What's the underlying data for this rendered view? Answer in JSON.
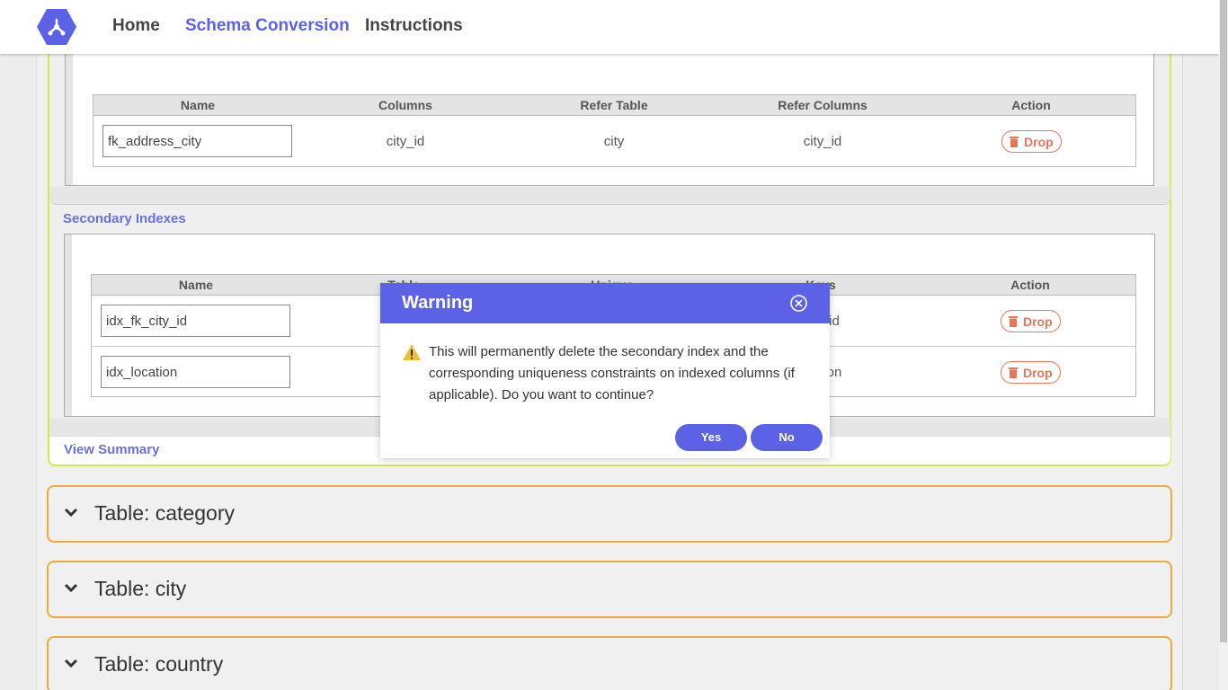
{
  "nav": {
    "home": "Home",
    "schema_conversion": "Schema Conversion",
    "instructions": "Instructions"
  },
  "foreign_keys": {
    "headers": [
      "Name",
      "Columns",
      "Refer Table",
      "Refer Columns",
      "Action"
    ],
    "rows": [
      {
        "name": "fk_address_city",
        "columns": "city_id",
        "refer_table": "city",
        "refer_columns": "city_id",
        "action": "Drop"
      }
    ]
  },
  "secondary_indexes": {
    "title": "Secondary Indexes",
    "headers": [
      "Name",
      "Table",
      "Unique",
      "Keys",
      "Action"
    ],
    "rows": [
      {
        "name": "idx_fk_city_id",
        "keys_visible": "id",
        "action": "Drop"
      },
      {
        "name": "idx_location",
        "keys_visible": "on",
        "action": "Drop"
      }
    ]
  },
  "view_summary": "View Summary",
  "tables": [
    {
      "title": "Table: category"
    },
    {
      "title": "Table: city"
    },
    {
      "title": "Table: country"
    }
  ],
  "modal": {
    "title": "Warning",
    "message": "This will permanently delete the secondary index and the corresponding uniqueness constraints on indexed columns (if applicable). Do you want to continue?",
    "yes": "Yes",
    "no": "No"
  },
  "colors": {
    "accent": "#5c62e6",
    "drop": "#e8755a",
    "accordion_border": "#f0a93a",
    "card_border": "#d8e84a"
  }
}
